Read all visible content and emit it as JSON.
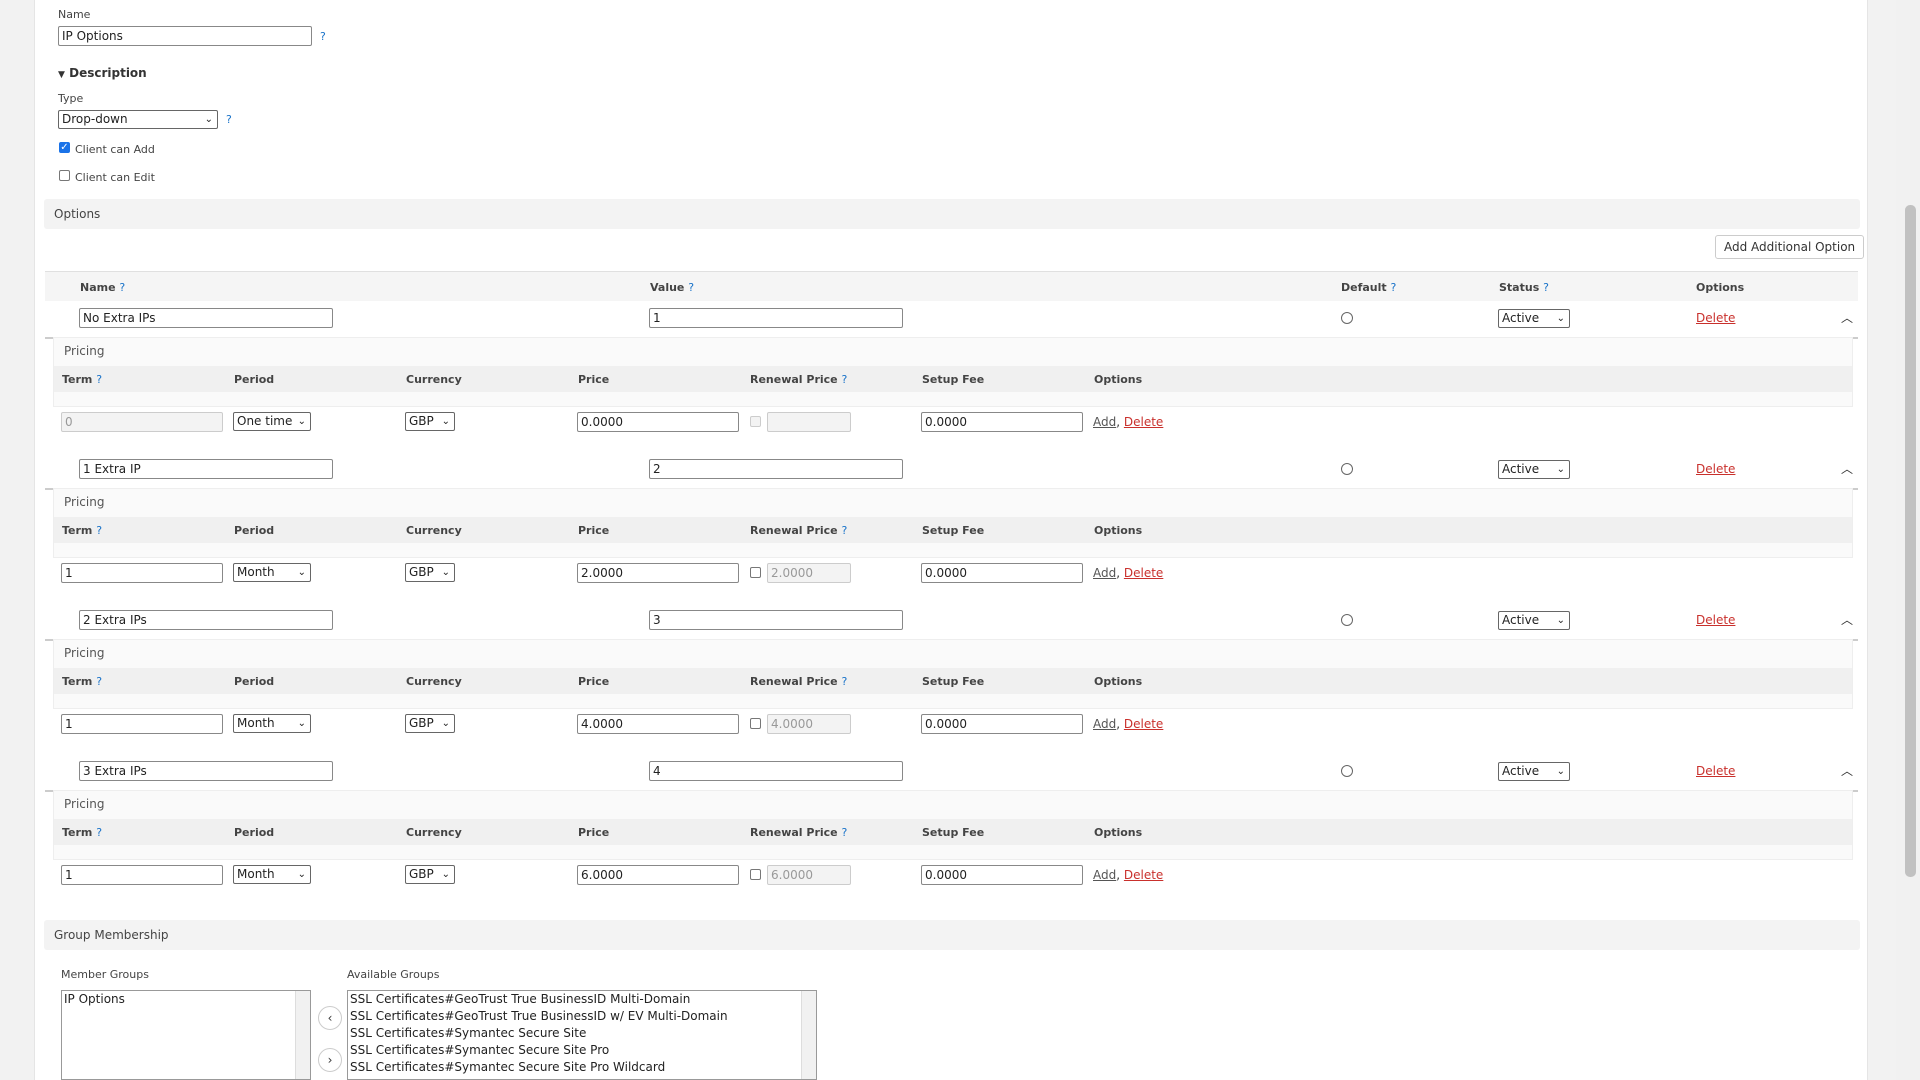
{
  "form": {
    "name_label": "Name",
    "name_value": "IP Options",
    "help": "?",
    "description_label": "Description",
    "type_label": "Type",
    "type_value": "Drop-down",
    "client_can_add": "Client can Add",
    "client_can_edit": "Client can Edit"
  },
  "options": {
    "panel_title": "Options",
    "add_button": "Add Additional Option",
    "headers": {
      "name": "Name",
      "value": "Value",
      "default": "Default",
      "status": "Status",
      "options": "Options"
    },
    "pricing_headers": {
      "term": "Term",
      "period": "Period",
      "currency": "Currency",
      "price": "Price",
      "renewal": "Renewal Price",
      "setup": "Setup Fee",
      "options": "Options"
    },
    "pricing_title": "Pricing",
    "delete_label": "Delete",
    "add_label": "Add",
    "comma": ",",
    "rows": [
      {
        "name": "No Extra IPs",
        "value": "1",
        "status": "Active",
        "term": "0",
        "period": "One time",
        "currency": "GBP",
        "price": "0.0000",
        "renewal": "",
        "setup": "0.0000"
      },
      {
        "name": "1 Extra IP",
        "value": "2",
        "status": "Active",
        "term": "1",
        "period": "Month",
        "currency": "GBP",
        "price": "2.0000",
        "renewal": "2.0000",
        "setup": "0.0000"
      },
      {
        "name": "2 Extra IPs",
        "value": "3",
        "status": "Active",
        "term": "1",
        "period": "Month",
        "currency": "GBP",
        "price": "4.0000",
        "renewal": "4.0000",
        "setup": "0.0000"
      },
      {
        "name": "3 Extra IPs",
        "value": "4",
        "status": "Active",
        "term": "1",
        "period": "Month",
        "currency": "GBP",
        "price": "6.0000",
        "renewal": "6.0000",
        "setup": "0.0000"
      }
    ]
  },
  "groups": {
    "panel_title": "Group Membership",
    "member_label": "Member Groups",
    "available_label": "Available Groups",
    "member_items": [
      "IP Options"
    ],
    "available_items": [
      "SSL Certificates#GeoTrust True BusinessID Multi-Domain",
      "SSL Certificates#GeoTrust True BusinessID w/ EV Multi-Domain",
      "SSL Certificates#Symantec Secure Site",
      "SSL Certificates#Symantec Secure Site Pro",
      "SSL Certificates#Symantec Secure Site Pro Wildcard"
    ]
  }
}
